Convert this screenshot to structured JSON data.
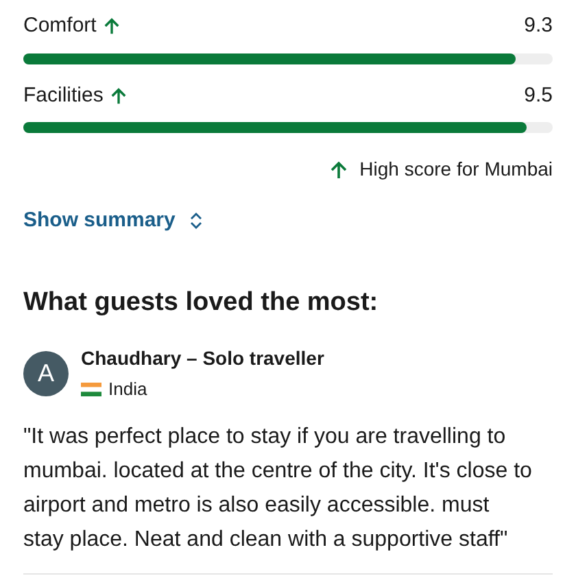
{
  "scores": [
    {
      "label": "Comfort",
      "high": true,
      "value": "9.3",
      "level": 0.93
    },
    {
      "label": "Facilities",
      "high": true,
      "value": "9.5",
      "level": 0.95
    }
  ],
  "high_score_note": "High score for Mumbai",
  "summary_link": "Show summary",
  "section_title": "What guests loved the most:",
  "review": {
    "avatar_letter": "A",
    "author": "Chaudhary – Solo traveller",
    "country": "India",
    "text": "\"It was perfect place to stay if you are travelling to mumbai. located at the centre of the city. It's close to airport and metro is also easily accessible. must stay place. Neat and clean with a supportive staff\""
  }
}
